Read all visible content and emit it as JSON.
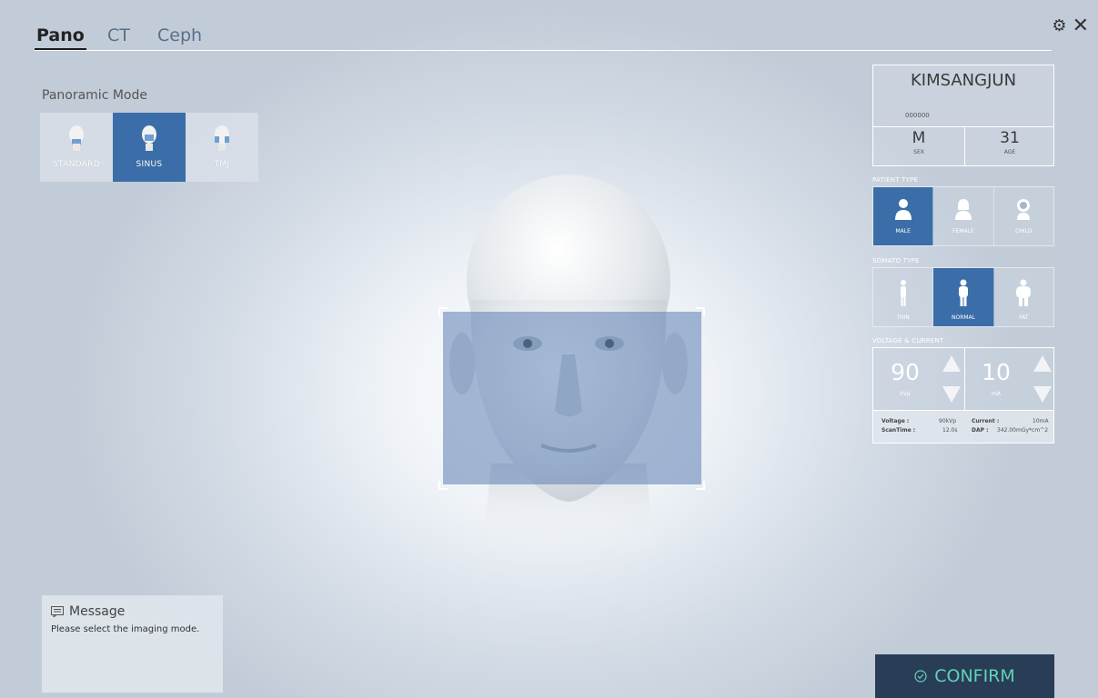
{
  "tabs": [
    {
      "label": "Pano",
      "active": true
    },
    {
      "label": "CT",
      "active": false
    },
    {
      "label": "Ceph",
      "active": false
    }
  ],
  "top_icons": {
    "settings": "gear-icon",
    "close": "close-icon"
  },
  "panoramic": {
    "title": "Panoramic Mode",
    "modes": [
      {
        "label": "STANDARD",
        "selected": false
      },
      {
        "label": "SINUS",
        "selected": true
      },
      {
        "label": "TMJ",
        "selected": false
      }
    ]
  },
  "patient": {
    "name": "KIMSANGJUN",
    "id": "000000",
    "sex_value": "M",
    "sex_label": "SEX",
    "age_value": "31",
    "age_label": "AGE"
  },
  "patient_type": {
    "title": "PATIENT TYPE",
    "options": [
      {
        "label": "MALE",
        "selected": true
      },
      {
        "label": "FEMALE",
        "selected": false
      },
      {
        "label": "CHILD",
        "selected": false
      }
    ]
  },
  "somato_type": {
    "title": "SOMATO TYPE",
    "options": [
      {
        "label": "THIN",
        "selected": false
      },
      {
        "label": "NORMAL",
        "selected": true
      },
      {
        "label": "FAT",
        "selected": false
      }
    ]
  },
  "voltage_current": {
    "title": "VOLTAGE & CURRENT",
    "kvp_value": "90",
    "kvp_unit": "kVp",
    "ma_value": "10",
    "ma_unit": "mA",
    "stats": {
      "voltage_label": "Voltage :",
      "voltage_value": "90kVp",
      "current_label": "Current :",
      "current_value": "10mA",
      "scantime_label": "ScanTime :",
      "scantime_value": "12.0s",
      "dap_label": "DAP :",
      "dap_value": "342.00mGy*cm^2"
    }
  },
  "message": {
    "title": "Message",
    "text": "Please select the imaging mode."
  },
  "confirm": {
    "label": "CONFIRM"
  },
  "colors": {
    "accent": "#3b6ea8",
    "confirm_bg": "#2a3d57",
    "confirm_text": "#5fd2b8"
  }
}
